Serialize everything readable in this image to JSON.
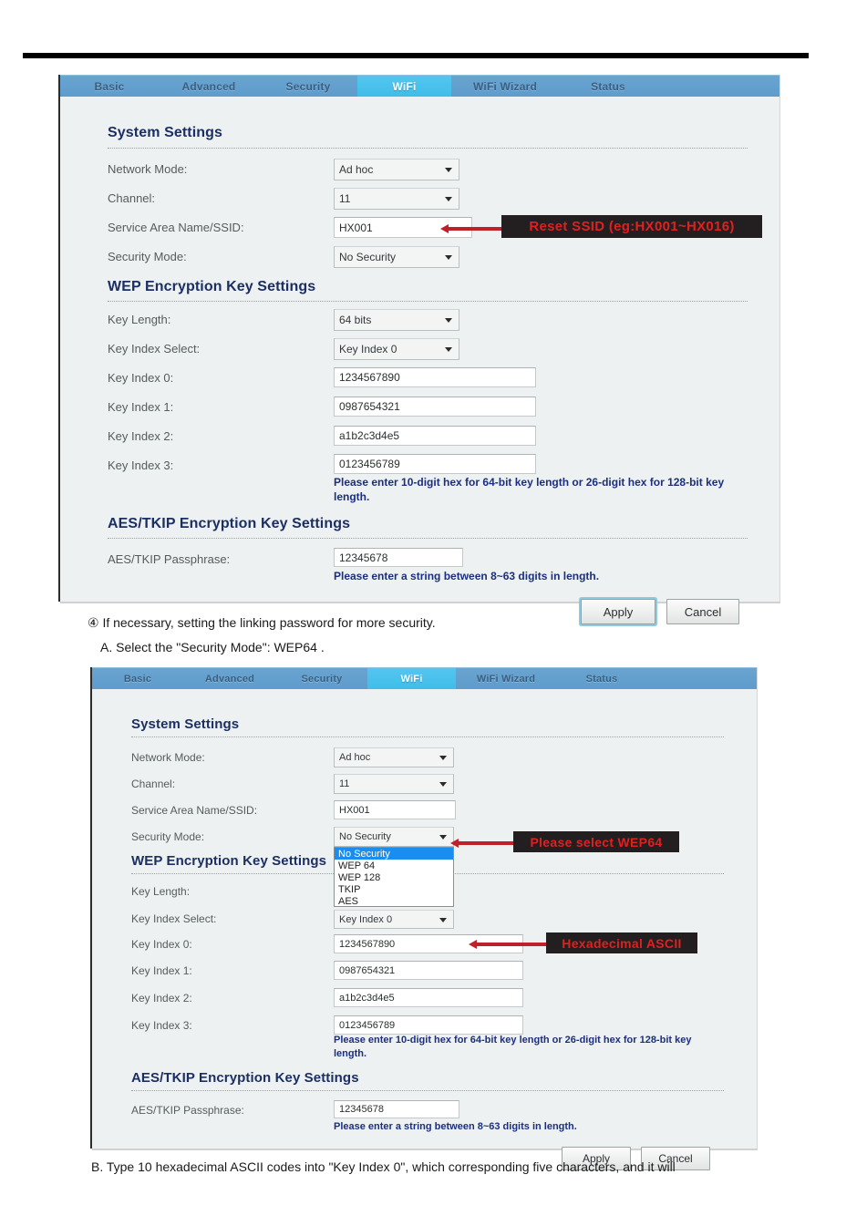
{
  "document": {
    "step_note": "④  If necessary, setting the linking password for more security.",
    "step_a": "A. Select the \"Security Mode\": WEP64 .",
    "step_b": "B. Type 10 hexadecimal ASCII codes into \"Key Index 0\", which corresponding five characters, and it will"
  },
  "colors": {
    "tab_bar": "#5e9ccc",
    "tab_active": "#3fbdea",
    "panel_bg": "#eef1f1",
    "section_title": "#1b2f63",
    "hint": "#1b2f7e",
    "callout_text": "#e02020",
    "callout_bg": "#231f20",
    "arrow": "#c0202a",
    "dropdown_selected": "#1a8ef0"
  },
  "tabs": [
    {
      "label": "Basic",
      "active": false
    },
    {
      "label": "Advanced",
      "active": false
    },
    {
      "label": "Security",
      "active": false
    },
    {
      "label": "WiFi",
      "active": true
    },
    {
      "label": "WiFi Wizard",
      "active": false
    },
    {
      "label": "Status",
      "active": false
    }
  ],
  "panel1": {
    "sections": {
      "system": "System Settings",
      "wep": "WEP Encryption Key Settings",
      "aes": "AES/TKIP Encryption Key Settings"
    },
    "fields": {
      "network_mode_label": "Network Mode:",
      "network_mode_value": "Ad hoc",
      "channel_label": "Channel:",
      "channel_value": "11",
      "ssid_label": "Service Area Name/SSID:",
      "ssid_value": "HX001",
      "security_mode_label": "Security Mode:",
      "security_mode_value": "No Security",
      "key_length_label": "Key Length:",
      "key_length_value": "64 bits",
      "key_index_select_label": "Key Index Select:",
      "key_index_select_value": "Key Index 0",
      "key0_label": "Key Index 0:",
      "key0_value": "1234567890",
      "key1_label": "Key Index 1:",
      "key1_value": "0987654321",
      "key2_label": "Key Index 2:",
      "key2_value": "a1b2c3d4e5",
      "key3_label": "Key Index 3:",
      "key3_value": "0123456789",
      "passphrase_label": "AES/TKIP Passphrase:",
      "passphrase_value": "12345678"
    },
    "hints": {
      "wep": "Please enter 10-digit hex for 64-bit key length or 26-digit hex for 128-bit key length.",
      "aes": "Please enter a string between 8~63 digits in length."
    },
    "buttons": {
      "apply": "Apply",
      "cancel": "Cancel"
    },
    "callout": "Reset  SSID (eg:HX001~HX016)"
  },
  "panel2": {
    "sections": {
      "system": "System Settings",
      "wep": "WEP Encryption Key Settings",
      "aes": "AES/TKIP Encryption Key Settings"
    },
    "fields": {
      "network_mode_label": "Network Mode:",
      "network_mode_value": "Ad hoc",
      "channel_label": "Channel:",
      "channel_value": "11",
      "ssid_label": "Service Area Name/SSID:",
      "ssid_value": "HX001",
      "security_mode_label": "Security Mode:",
      "security_mode_value": "No Security",
      "key_length_label": "Key Length:",
      "key_index_select_label": "Key Index Select:",
      "key_index_select_value": "Key Index 0",
      "key0_label": "Key Index 0:",
      "key0_value": "1234567890",
      "key1_label": "Key Index 1:",
      "key1_value": "0987654321",
      "key2_label": "Key Index 2:",
      "key2_value": "a1b2c3d4e5",
      "key3_label": "Key Index 3:",
      "key3_value": "0123456789",
      "passphrase_label": "AES/TKIP Passphrase:",
      "passphrase_value": "12345678"
    },
    "security_options": [
      {
        "label": "No Security",
        "selected": true
      },
      {
        "label": "WEP 64",
        "selected": false
      },
      {
        "label": "WEP 128",
        "selected": false
      },
      {
        "label": "TKIP",
        "selected": false
      },
      {
        "label": "AES",
        "selected": false
      }
    ],
    "hints": {
      "wep": "Please enter 10-digit hex for 64-bit key length or 26-digit hex for 128-bit key length.",
      "aes": "Please enter a string between 8~63 digits in length."
    },
    "buttons": {
      "apply": "Apply",
      "cancel": "Cancel"
    },
    "callout_security": "Please select WEP64",
    "callout_hex": "Hexadecimal ASCII"
  }
}
